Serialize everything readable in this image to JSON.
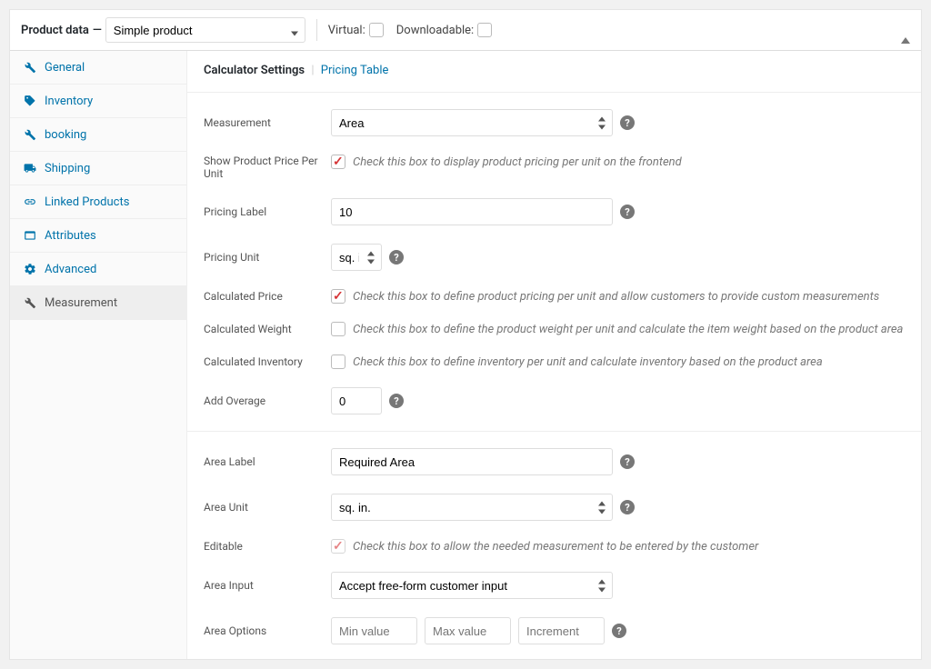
{
  "header": {
    "title": "Product data",
    "product_type": "Simple product",
    "virtual_label": "Virtual:",
    "downloadable_label": "Downloadable:"
  },
  "tabs": [
    {
      "label": "General",
      "icon": "wrench"
    },
    {
      "label": "Inventory",
      "icon": "tag"
    },
    {
      "label": "booking",
      "icon": "wrench"
    },
    {
      "label": "Shipping",
      "icon": "truck"
    },
    {
      "label": "Linked Products",
      "icon": "link"
    },
    {
      "label": "Attributes",
      "icon": "card"
    },
    {
      "label": "Advanced",
      "icon": "gear"
    },
    {
      "label": "Measurement",
      "icon": "wrench"
    }
  ],
  "subnav": {
    "active": "Calculator Settings",
    "link": "Pricing Table"
  },
  "fields": {
    "measurement": {
      "label": "Measurement",
      "value": "Area"
    },
    "show_price": {
      "label": "Show Product Price Per Unit",
      "desc": "Check this box to display product pricing per unit on the frontend",
      "checked": true
    },
    "pricing_label": {
      "label": "Pricing Label",
      "value": "10"
    },
    "pricing_unit": {
      "label": "Pricing Unit",
      "value": "sq. in."
    },
    "calc_price": {
      "label": "Calculated Price",
      "desc": "Check this box to define product pricing per unit and allow customers to provide custom measurements",
      "checked": true
    },
    "calc_weight": {
      "label": "Calculated Weight",
      "desc": "Check this box to define the product weight per unit and calculate the item weight based on the product area",
      "checked": false
    },
    "calc_inventory": {
      "label": "Calculated Inventory",
      "desc": "Check this box to define inventory per unit and calculate inventory based on the product area",
      "checked": false
    },
    "overage": {
      "label": "Add Overage",
      "value": "0"
    },
    "area_label": {
      "label": "Area Label",
      "value": "Required Area"
    },
    "area_unit": {
      "label": "Area Unit",
      "value": "sq. in."
    },
    "editable": {
      "label": "Editable",
      "desc": "Check this box to allow the needed measurement to be entered by the customer",
      "checked": true,
      "disabled": true
    },
    "area_input": {
      "label": "Area Input",
      "value": "Accept free-form customer input"
    },
    "area_options": {
      "label": "Area Options",
      "min_ph": "Min value",
      "max_ph": "Max value",
      "inc_ph": "Increment"
    }
  }
}
